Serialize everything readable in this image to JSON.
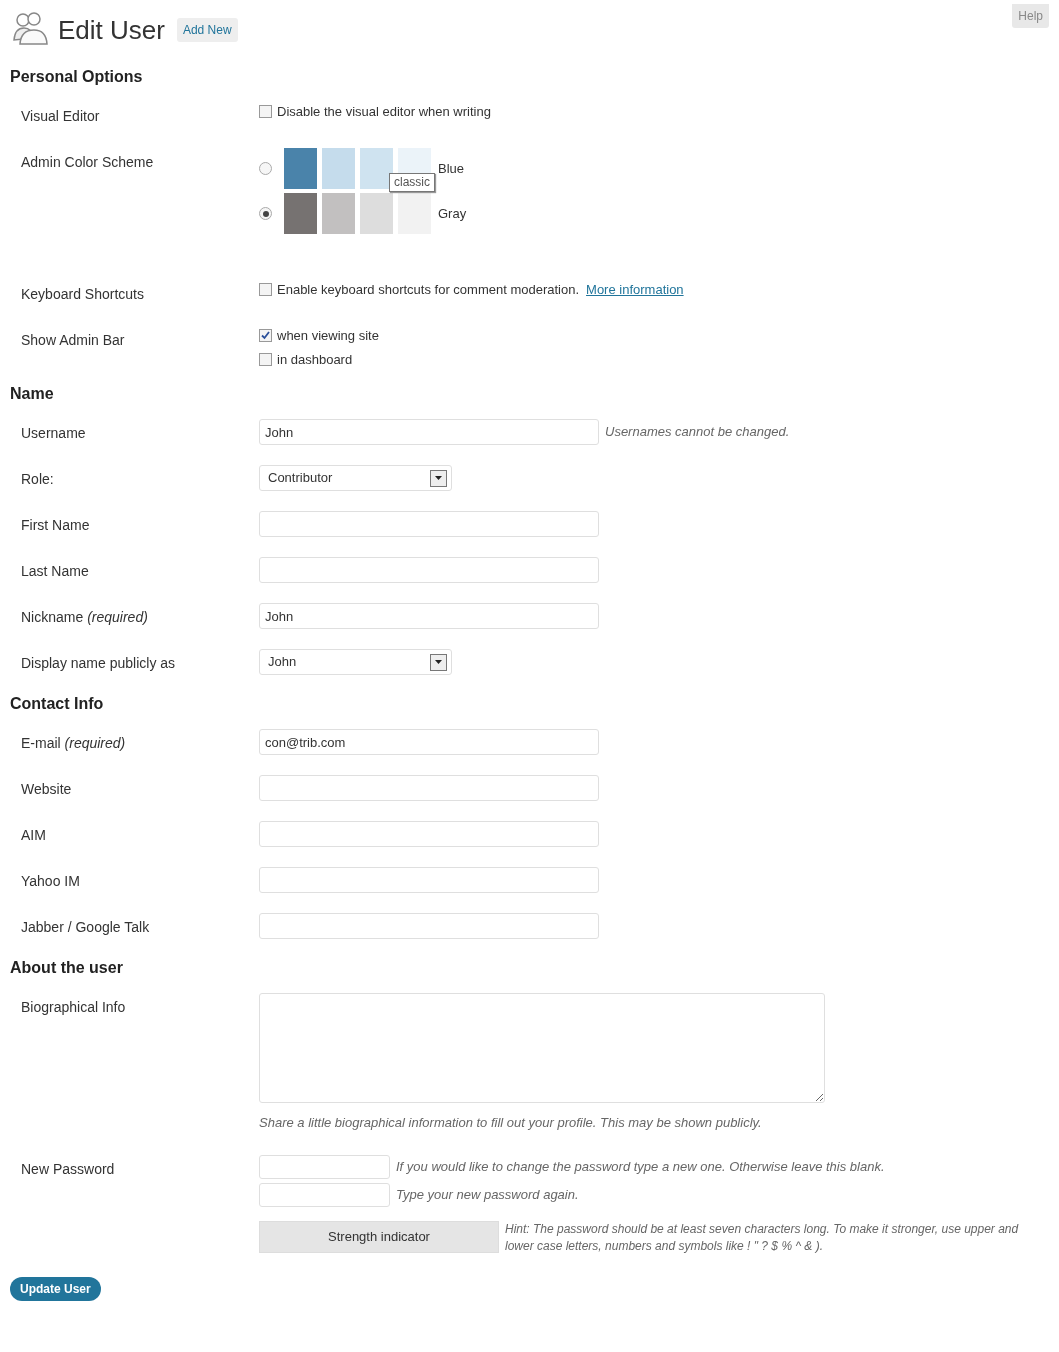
{
  "header": {
    "title": "Edit User",
    "add_new": "Add New",
    "help": "Help"
  },
  "sections": [
    {
      "heading": "Personal Options",
      "rows": [
        {
          "kind": "checkbox",
          "label": "Visual Editor",
          "options": [
            {
              "text": "Disable the visual editor when writing",
              "checked": false
            }
          ]
        },
        {
          "kind": "colors",
          "label": "Admin Color Scheme",
          "tooltip": "classic",
          "schemes": [
            {
              "name": "Blue",
              "selected": false,
              "swatches": [
                {
                  "color": "#4a83aa"
                },
                {
                  "color": "#c5dcec"
                },
                {
                  "color": "#cfe3f0"
                },
                {
                  "color": "#ebf3f9"
                }
              ]
            },
            {
              "name": "Gray",
              "selected": true,
              "swatches": [
                {
                  "color": "#767271"
                },
                {
                  "color": "#c2c0c0"
                },
                {
                  "color": "#dddddd"
                },
                {
                  "color": "#f2f2f2"
                }
              ]
            }
          ]
        },
        {
          "kind": "checkbox",
          "label": "Keyboard Shortcuts",
          "options": [
            {
              "text": "Enable keyboard shortcuts for comment moderation.",
              "checked": false,
              "link": "More information"
            }
          ]
        },
        {
          "kind": "checkbox",
          "label": "Show Admin Bar",
          "options": [
            {
              "text": "when viewing site",
              "checked": true
            },
            {
              "text": "in dashboard",
              "checked": false
            }
          ]
        }
      ]
    },
    {
      "heading": "Name",
      "rows": [
        {
          "kind": "text",
          "label": "Username",
          "value": "John",
          "description": "Usernames cannot be changed."
        },
        {
          "kind": "select",
          "label": "Role:",
          "value": "Contributor"
        },
        {
          "kind": "text",
          "label": "First Name"
        },
        {
          "kind": "text",
          "label": "Last Name"
        },
        {
          "kind": "text",
          "label": "Nickname *(required)*",
          "value": "John"
        },
        {
          "kind": "select",
          "label": "Display name publicly as",
          "value": "John"
        }
      ]
    },
    {
      "heading": "Contact Info",
      "rows": [
        {
          "kind": "text",
          "label": "E-mail *(required)*",
          "value": "con@trib.com"
        },
        {
          "kind": "text",
          "label": "Website"
        },
        {
          "kind": "text",
          "label": "AIM"
        },
        {
          "kind": "text",
          "label": "Yahoo IM"
        },
        {
          "kind": "text",
          "label": "Jabber / Google Talk"
        }
      ]
    },
    {
      "heading": "About the user",
      "rows": [
        {
          "kind": "textarea",
          "label": "Biographical Info",
          "description": "Share a little biographical information to fill out your profile. This may be shown publicly."
        },
        {
          "kind": "password",
          "label": "New Password",
          "fields": [
            {
              "description": "If you would like to change the password type a new one. Otherwise leave this blank."
            },
            {
              "description": "Type your new password again."
            }
          ],
          "strength": "Strength indicator",
          "hint": "Hint: The password should be at least seven characters long. To make it stronger, use upper and lower case letters, numbers and symbols like ! \" ? $ % ^ & )."
        }
      ]
    }
  ],
  "submit": "Update User"
}
